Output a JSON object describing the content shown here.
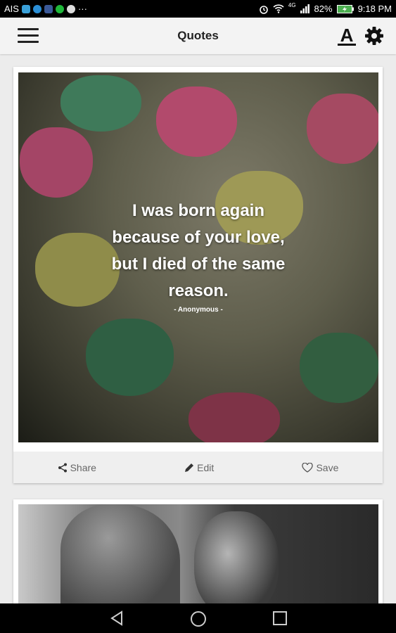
{
  "status_bar": {
    "carrier": "AIS",
    "overflow": "···",
    "network": "4G",
    "battery": "82%",
    "time": "9:18 PM"
  },
  "toolbar": {
    "title": "Quotes",
    "font_icon_glyph": "A"
  },
  "cards": [
    {
      "quote_lines": [
        "I was born again",
        "because of your love,",
        "but I died of the same",
        "reason."
      ],
      "author": "- Anonymous -",
      "actions": {
        "share": "Share",
        "edit": "Edit",
        "save": "Save"
      }
    }
  ],
  "colors": {
    "toolbar_bg": "#f3f3f3",
    "page_bg": "#ececec",
    "action_text": "#666666"
  }
}
